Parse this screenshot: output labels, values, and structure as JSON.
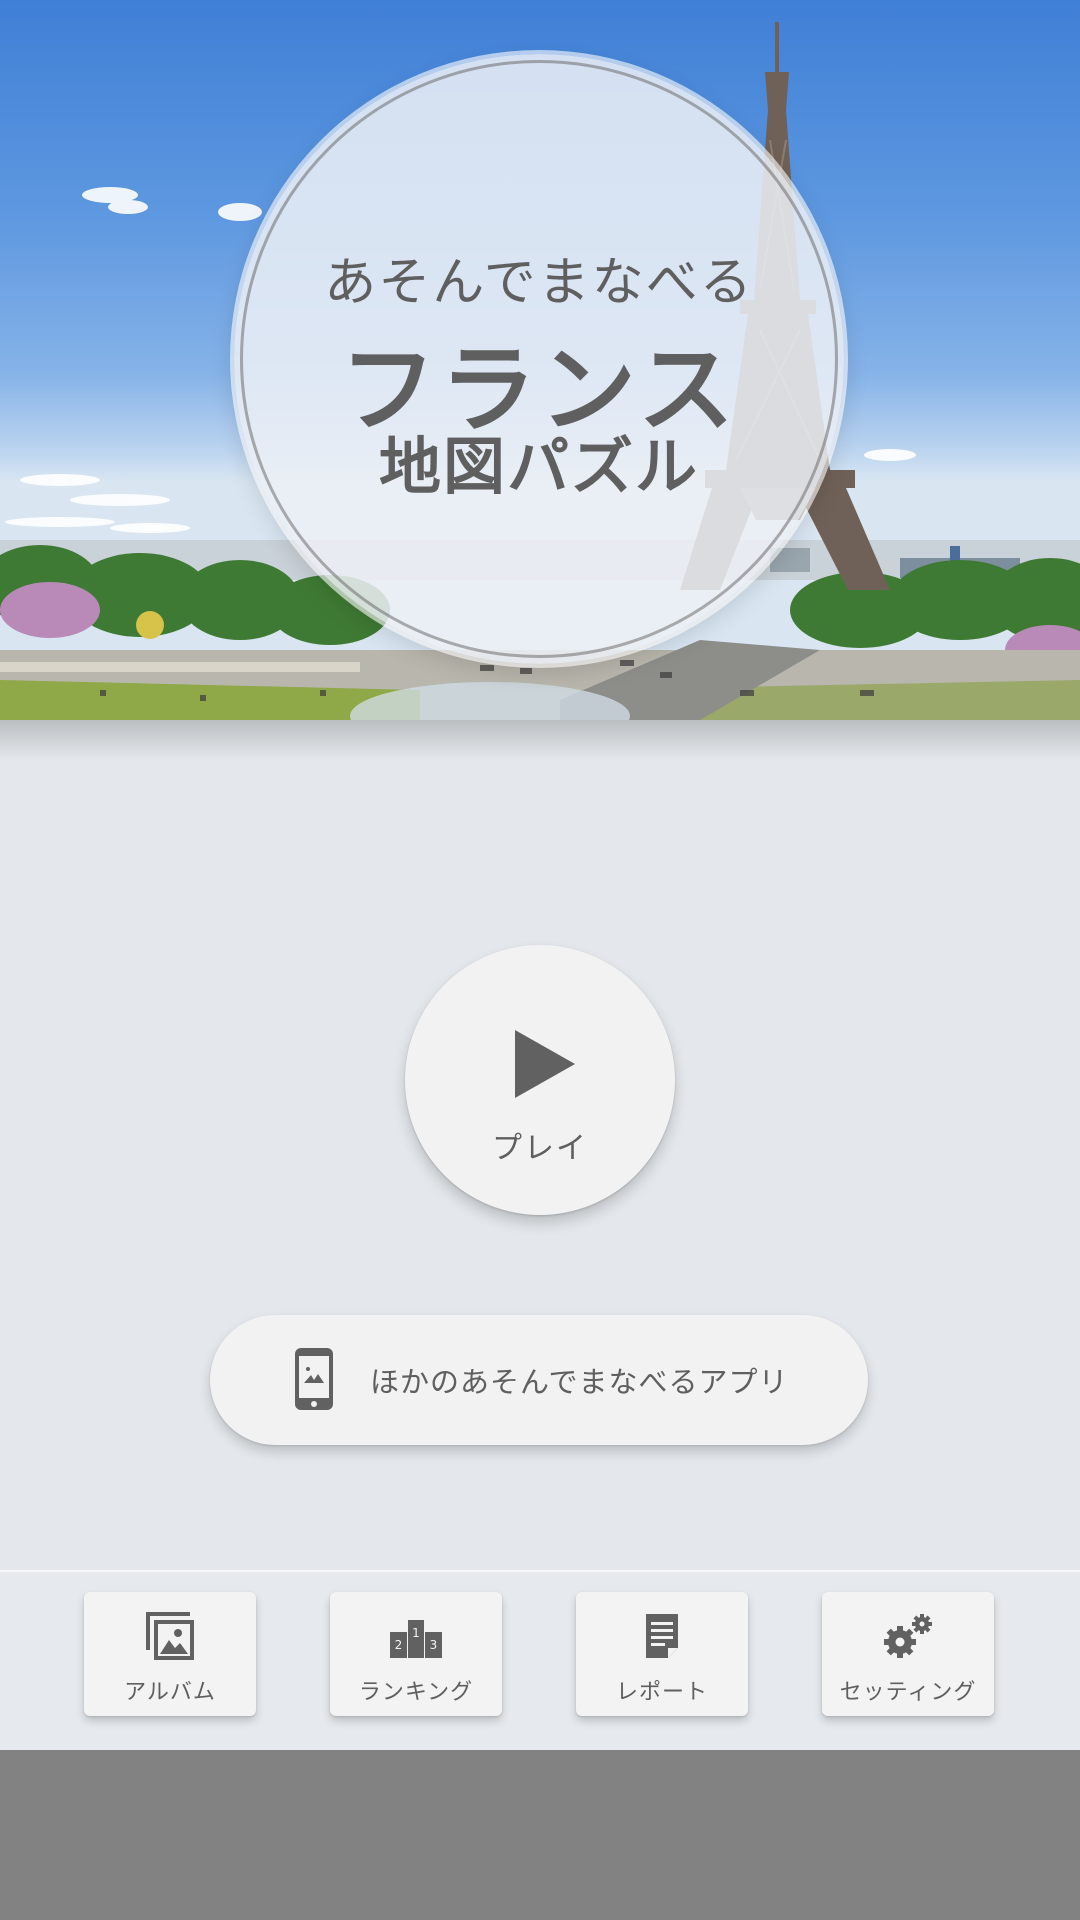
{
  "header": {
    "subtitle": "あそんでまなべる",
    "title": "フランス",
    "third_line": "地図パズル",
    "background": "paris-eiffel-tower-photo"
  },
  "play": {
    "label": "プレイ",
    "icon": "play-triangle-icon"
  },
  "other_apps": {
    "label": "ほかのあそんでまなべるアプリ",
    "icon": "smartphone-icon"
  },
  "menu": {
    "items": [
      {
        "label": "アルバム",
        "icon": "album-icon"
      },
      {
        "label": "ランキング",
        "icon": "ranking-podium-icon"
      },
      {
        "label": "レポート",
        "icon": "report-document-icon"
      },
      {
        "label": "セッティング",
        "icon": "gears-icon"
      }
    ]
  },
  "colors": {
    "text": "#5f5f5f",
    "background": "#e4e8ec",
    "button": "#f2f2f2",
    "nav_bar": "#828282"
  }
}
